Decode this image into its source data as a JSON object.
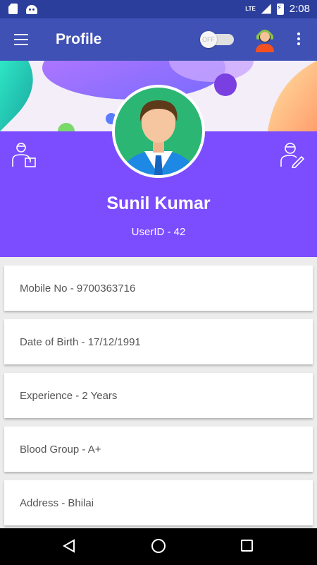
{
  "status_bar": {
    "time": "2:08",
    "network": "LTE"
  },
  "app_bar": {
    "title": "Profile",
    "toggle_label": "OFF"
  },
  "profile": {
    "name": "Sunil Kumar",
    "user_id": "UserID - 42"
  },
  "details": [
    {
      "text": "Mobile No - 9700363716"
    },
    {
      "text": "Date of Birth - 17/12/1991"
    },
    {
      "text": "Experience - 2 Years"
    },
    {
      "text": "Blood Group - A+"
    },
    {
      "text": "Address - Bhilai"
    }
  ],
  "colors": {
    "status_bar": "#2c3e9c",
    "app_bar": "#3f51b5",
    "header_panel": "#7c4dff",
    "avatar_bg": "#2bb673"
  }
}
